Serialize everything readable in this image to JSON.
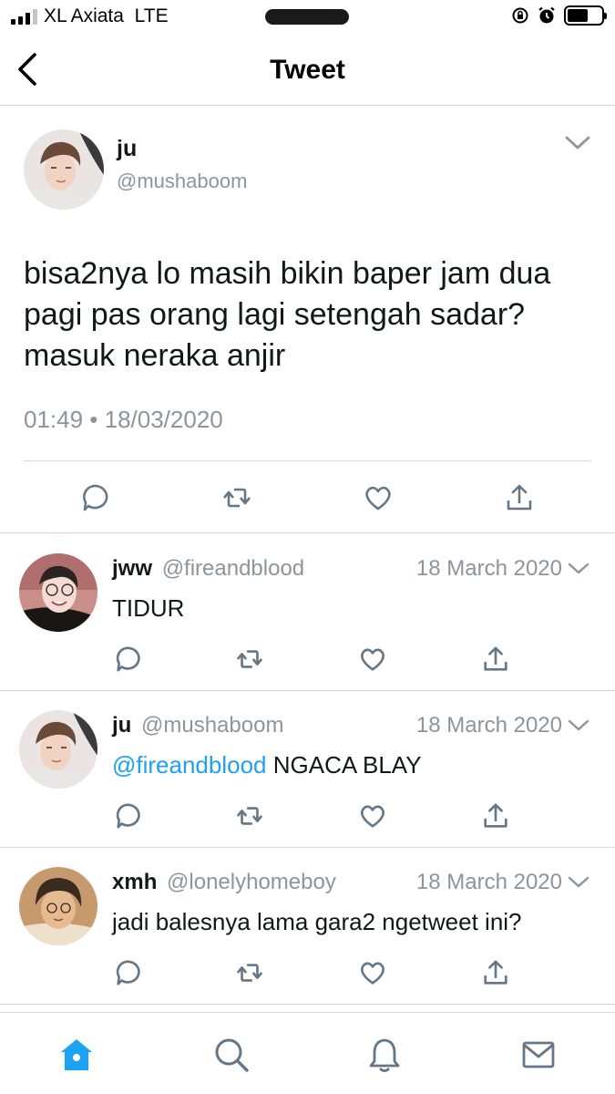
{
  "status_bar": {
    "carrier": "XL Axiata",
    "network": "LTE",
    "battery_level": 0.6,
    "icons": [
      "signal-icon",
      "orientation-lock-icon",
      "alarm-icon",
      "battery-icon"
    ]
  },
  "nav": {
    "title": "Tweet",
    "back_icon": "chevron-left-icon"
  },
  "main_tweet": {
    "name": "ju",
    "handle": "@mushaboom",
    "text": "bisa2nya lo masih bikin baper jam dua pagi pas orang lagi setengah sadar? masuk neraka anjir",
    "timestamp": "01:49 • 18/03/2020",
    "actions": [
      "reply-icon",
      "retweet-icon",
      "like-icon",
      "share-icon"
    ]
  },
  "replies": [
    {
      "name": "jww",
      "handle": "@fireandblood",
      "date": "18 March 2020",
      "mention": "",
      "text": "TIDUR"
    },
    {
      "name": "ju",
      "handle": "@mushaboom",
      "date": "18 March 2020",
      "mention": "@fireandblood",
      "text": " NGACA BLAY"
    },
    {
      "name": "xmh",
      "handle": "@lonelyhomeboy",
      "date": "18 March 2020",
      "mention": "",
      "text": "jadi balesnya lama gara2 ngetweet ini?"
    }
  ],
  "tab_bar": {
    "items": [
      "home-icon",
      "search-icon",
      "notifications-icon",
      "messages-icon"
    ],
    "active": "home-icon"
  },
  "colors": {
    "accent": "#1da1f2",
    "secondary_text": "#8a959e",
    "icon_gray": "#657786",
    "divider": "#d3d6d9"
  }
}
